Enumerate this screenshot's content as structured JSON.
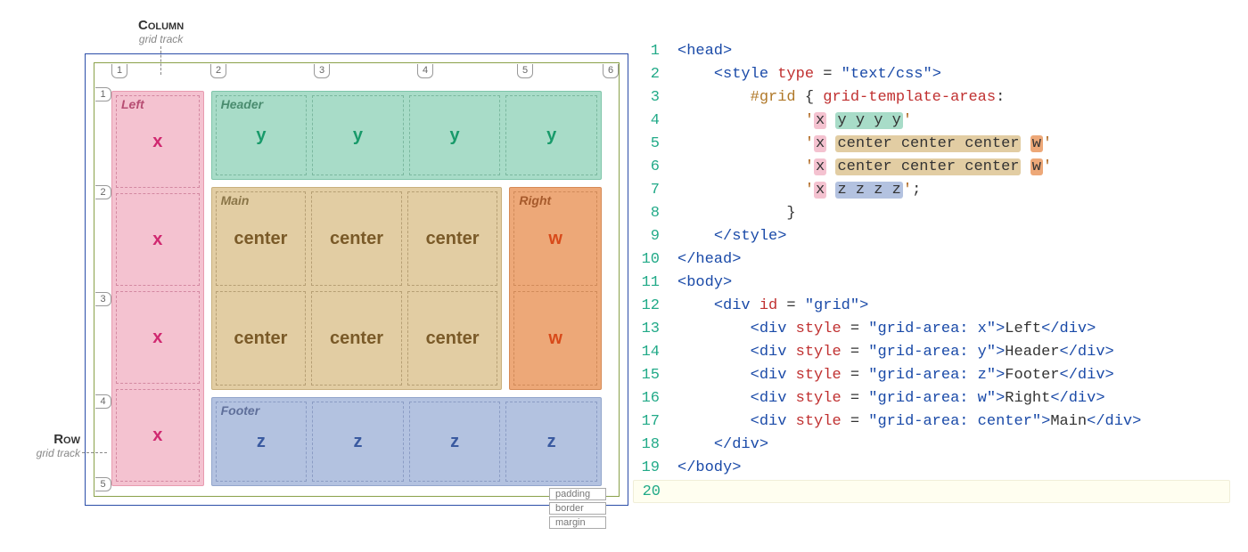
{
  "diagram": {
    "column_label": "Column",
    "row_label": "Row",
    "track_label": "grid track",
    "regions": {
      "left": {
        "label": "Left",
        "letter": "x",
        "cells": [
          "x",
          "x",
          "x",
          "x"
        ]
      },
      "header": {
        "label": "Header",
        "letter": "y",
        "cells": [
          "y",
          "y",
          "y",
          "y"
        ]
      },
      "main": {
        "label": "Main",
        "letter": "center",
        "cells": [
          "center",
          "center",
          "center",
          "center",
          "center",
          "center"
        ]
      },
      "right": {
        "label": "Right",
        "letter": "w",
        "cells": [
          "w",
          "w"
        ]
      },
      "footer": {
        "label": "Footer",
        "letter": "z",
        "cells": [
          "z",
          "z",
          "z",
          "z"
        ]
      }
    },
    "legend": {
      "padding": "padding",
      "border": "border",
      "margin": "margin"
    },
    "col_lines": [
      "1",
      "2",
      "3",
      "4",
      "5",
      "6"
    ],
    "row_lines": [
      "1",
      "2",
      "3",
      "4",
      "5"
    ]
  },
  "code": {
    "lines": [
      {
        "n": "1",
        "t": [
          [
            "tag",
            "<head>"
          ]
        ]
      },
      {
        "n": "2",
        "t": [
          [
            "txt",
            "    "
          ],
          [
            "tag",
            "<style"
          ],
          [
            "txt",
            " "
          ],
          [
            "attr",
            "type"
          ],
          [
            "txt",
            " = "
          ],
          [
            "val",
            "\"text/css\""
          ],
          [
            "tag",
            ">"
          ]
        ]
      },
      {
        "n": "3",
        "t": [
          [
            "txt",
            "        "
          ],
          [
            "sel",
            "#grid"
          ],
          [
            "txt",
            " { "
          ],
          [
            "prop",
            "grid-template-areas"
          ],
          [
            "txt",
            ":"
          ]
        ]
      },
      {
        "n": "4",
        "t": [
          [
            "txt",
            "              "
          ],
          [
            "quote",
            "'"
          ],
          [
            "hl-x",
            "x"
          ],
          [
            "txt",
            " "
          ],
          [
            "hl-y",
            "y y y y"
          ],
          [
            "quote",
            "'"
          ]
        ]
      },
      {
        "n": "5",
        "t": [
          [
            "txt",
            "              "
          ],
          [
            "quote",
            "'"
          ],
          [
            "hl-x",
            "x"
          ],
          [
            "txt",
            " "
          ],
          [
            "hl-c",
            "center center center"
          ],
          [
            "txt",
            " "
          ],
          [
            "hl-w",
            "w"
          ],
          [
            "quote",
            "'"
          ]
        ]
      },
      {
        "n": "6",
        "t": [
          [
            "txt",
            "              "
          ],
          [
            "quote",
            "'"
          ],
          [
            "hl-x",
            "x"
          ],
          [
            "txt",
            " "
          ],
          [
            "hl-c",
            "center center center"
          ],
          [
            "txt",
            " "
          ],
          [
            "hl-w",
            "w"
          ],
          [
            "quote",
            "'"
          ]
        ]
      },
      {
        "n": "7",
        "t": [
          [
            "txt",
            "              "
          ],
          [
            "quote",
            "'"
          ],
          [
            "hl-x",
            "x"
          ],
          [
            "txt",
            " "
          ],
          [
            "hl-z",
            "z z z z"
          ],
          [
            "quote",
            "'"
          ],
          [
            "txt",
            ";"
          ]
        ]
      },
      {
        "n": "8",
        "t": [
          [
            "txt",
            "            }"
          ]
        ]
      },
      {
        "n": "9",
        "t": [
          [
            "txt",
            "    "
          ],
          [
            "tag",
            "</style>"
          ]
        ]
      },
      {
        "n": "10",
        "t": [
          [
            "tag",
            "</head>"
          ]
        ]
      },
      {
        "n": "11",
        "t": [
          [
            "tag",
            "<body>"
          ]
        ]
      },
      {
        "n": "12",
        "t": [
          [
            "txt",
            "    "
          ],
          [
            "tag",
            "<div"
          ],
          [
            "txt",
            " "
          ],
          [
            "attr",
            "id"
          ],
          [
            "txt",
            " = "
          ],
          [
            "val",
            "\"grid\""
          ],
          [
            "tag",
            ">"
          ]
        ]
      },
      {
        "n": "13",
        "t": [
          [
            "txt",
            "        "
          ],
          [
            "tag",
            "<div"
          ],
          [
            "txt",
            " "
          ],
          [
            "attr",
            "style"
          ],
          [
            "txt",
            " = "
          ],
          [
            "val",
            "\"grid-area: x\""
          ],
          [
            "tag",
            ">"
          ],
          [
            "txt",
            "Left"
          ],
          [
            "tag",
            "</div>"
          ]
        ]
      },
      {
        "n": "14",
        "t": [
          [
            "txt",
            "        "
          ],
          [
            "tag",
            "<div"
          ],
          [
            "txt",
            " "
          ],
          [
            "attr",
            "style"
          ],
          [
            "txt",
            " = "
          ],
          [
            "val",
            "\"grid-area: y\""
          ],
          [
            "tag",
            ">"
          ],
          [
            "txt",
            "Header"
          ],
          [
            "tag",
            "</div>"
          ]
        ]
      },
      {
        "n": "15",
        "t": [
          [
            "txt",
            "        "
          ],
          [
            "tag",
            "<div"
          ],
          [
            "txt",
            " "
          ],
          [
            "attr",
            "style"
          ],
          [
            "txt",
            " = "
          ],
          [
            "val",
            "\"grid-area: z\""
          ],
          [
            "tag",
            ">"
          ],
          [
            "txt",
            "Footer"
          ],
          [
            "tag",
            "</div>"
          ]
        ]
      },
      {
        "n": "16",
        "t": [
          [
            "txt",
            "        "
          ],
          [
            "tag",
            "<div"
          ],
          [
            "txt",
            " "
          ],
          [
            "attr",
            "style"
          ],
          [
            "txt",
            " = "
          ],
          [
            "val",
            "\"grid-area: w\""
          ],
          [
            "tag",
            ">"
          ],
          [
            "txt",
            "Right"
          ],
          [
            "tag",
            "</div>"
          ]
        ]
      },
      {
        "n": "17",
        "t": [
          [
            "txt",
            "        "
          ],
          [
            "tag",
            "<div"
          ],
          [
            "txt",
            " "
          ],
          [
            "attr",
            "style"
          ],
          [
            "txt",
            " = "
          ],
          [
            "val",
            "\"grid-area: center\""
          ],
          [
            "tag",
            ">"
          ],
          [
            "txt",
            "Main"
          ],
          [
            "tag",
            "</div>"
          ]
        ]
      },
      {
        "n": "18",
        "t": [
          [
            "txt",
            "    "
          ],
          [
            "tag",
            "</div>"
          ]
        ]
      },
      {
        "n": "19",
        "t": [
          [
            "tag",
            "</body>"
          ]
        ]
      },
      {
        "n": "20",
        "t": [
          [
            "txt",
            ""
          ]
        ]
      }
    ]
  }
}
